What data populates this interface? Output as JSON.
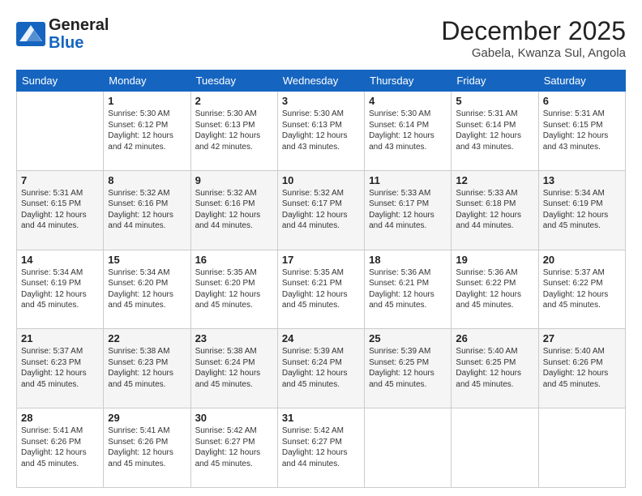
{
  "logo": {
    "line1": "General",
    "line2": "Blue"
  },
  "title": "December 2025",
  "location": "Gabela, Kwanza Sul, Angola",
  "days_of_week": [
    "Sunday",
    "Monday",
    "Tuesday",
    "Wednesday",
    "Thursday",
    "Friday",
    "Saturday"
  ],
  "weeks": [
    [
      {
        "day": "",
        "info": ""
      },
      {
        "day": "1",
        "info": "Sunrise: 5:30 AM\nSunset: 6:12 PM\nDaylight: 12 hours\nand 42 minutes."
      },
      {
        "day": "2",
        "info": "Sunrise: 5:30 AM\nSunset: 6:13 PM\nDaylight: 12 hours\nand 42 minutes."
      },
      {
        "day": "3",
        "info": "Sunrise: 5:30 AM\nSunset: 6:13 PM\nDaylight: 12 hours\nand 43 minutes."
      },
      {
        "day": "4",
        "info": "Sunrise: 5:30 AM\nSunset: 6:14 PM\nDaylight: 12 hours\nand 43 minutes."
      },
      {
        "day": "5",
        "info": "Sunrise: 5:31 AM\nSunset: 6:14 PM\nDaylight: 12 hours\nand 43 minutes."
      },
      {
        "day": "6",
        "info": "Sunrise: 5:31 AM\nSunset: 6:15 PM\nDaylight: 12 hours\nand 43 minutes."
      }
    ],
    [
      {
        "day": "7",
        "info": "Sunrise: 5:31 AM\nSunset: 6:15 PM\nDaylight: 12 hours\nand 44 minutes."
      },
      {
        "day": "8",
        "info": "Sunrise: 5:32 AM\nSunset: 6:16 PM\nDaylight: 12 hours\nand 44 minutes."
      },
      {
        "day": "9",
        "info": "Sunrise: 5:32 AM\nSunset: 6:16 PM\nDaylight: 12 hours\nand 44 minutes."
      },
      {
        "day": "10",
        "info": "Sunrise: 5:32 AM\nSunset: 6:17 PM\nDaylight: 12 hours\nand 44 minutes."
      },
      {
        "day": "11",
        "info": "Sunrise: 5:33 AM\nSunset: 6:17 PM\nDaylight: 12 hours\nand 44 minutes."
      },
      {
        "day": "12",
        "info": "Sunrise: 5:33 AM\nSunset: 6:18 PM\nDaylight: 12 hours\nand 44 minutes."
      },
      {
        "day": "13",
        "info": "Sunrise: 5:34 AM\nSunset: 6:19 PM\nDaylight: 12 hours\nand 45 minutes."
      }
    ],
    [
      {
        "day": "14",
        "info": "Sunrise: 5:34 AM\nSunset: 6:19 PM\nDaylight: 12 hours\nand 45 minutes."
      },
      {
        "day": "15",
        "info": "Sunrise: 5:34 AM\nSunset: 6:20 PM\nDaylight: 12 hours\nand 45 minutes."
      },
      {
        "day": "16",
        "info": "Sunrise: 5:35 AM\nSunset: 6:20 PM\nDaylight: 12 hours\nand 45 minutes."
      },
      {
        "day": "17",
        "info": "Sunrise: 5:35 AM\nSunset: 6:21 PM\nDaylight: 12 hours\nand 45 minutes."
      },
      {
        "day": "18",
        "info": "Sunrise: 5:36 AM\nSunset: 6:21 PM\nDaylight: 12 hours\nand 45 minutes."
      },
      {
        "day": "19",
        "info": "Sunrise: 5:36 AM\nSunset: 6:22 PM\nDaylight: 12 hours\nand 45 minutes."
      },
      {
        "day": "20",
        "info": "Sunrise: 5:37 AM\nSunset: 6:22 PM\nDaylight: 12 hours\nand 45 minutes."
      }
    ],
    [
      {
        "day": "21",
        "info": "Sunrise: 5:37 AM\nSunset: 6:23 PM\nDaylight: 12 hours\nand 45 minutes."
      },
      {
        "day": "22",
        "info": "Sunrise: 5:38 AM\nSunset: 6:23 PM\nDaylight: 12 hours\nand 45 minutes."
      },
      {
        "day": "23",
        "info": "Sunrise: 5:38 AM\nSunset: 6:24 PM\nDaylight: 12 hours\nand 45 minutes."
      },
      {
        "day": "24",
        "info": "Sunrise: 5:39 AM\nSunset: 6:24 PM\nDaylight: 12 hours\nand 45 minutes."
      },
      {
        "day": "25",
        "info": "Sunrise: 5:39 AM\nSunset: 6:25 PM\nDaylight: 12 hours\nand 45 minutes."
      },
      {
        "day": "26",
        "info": "Sunrise: 5:40 AM\nSunset: 6:25 PM\nDaylight: 12 hours\nand 45 minutes."
      },
      {
        "day": "27",
        "info": "Sunrise: 5:40 AM\nSunset: 6:26 PM\nDaylight: 12 hours\nand 45 minutes."
      }
    ],
    [
      {
        "day": "28",
        "info": "Sunrise: 5:41 AM\nSunset: 6:26 PM\nDaylight: 12 hours\nand 45 minutes."
      },
      {
        "day": "29",
        "info": "Sunrise: 5:41 AM\nSunset: 6:26 PM\nDaylight: 12 hours\nand 45 minutes."
      },
      {
        "day": "30",
        "info": "Sunrise: 5:42 AM\nSunset: 6:27 PM\nDaylight: 12 hours\nand 45 minutes."
      },
      {
        "day": "31",
        "info": "Sunrise: 5:42 AM\nSunset: 6:27 PM\nDaylight: 12 hours\nand 44 minutes."
      },
      {
        "day": "",
        "info": ""
      },
      {
        "day": "",
        "info": ""
      },
      {
        "day": "",
        "info": ""
      }
    ]
  ]
}
